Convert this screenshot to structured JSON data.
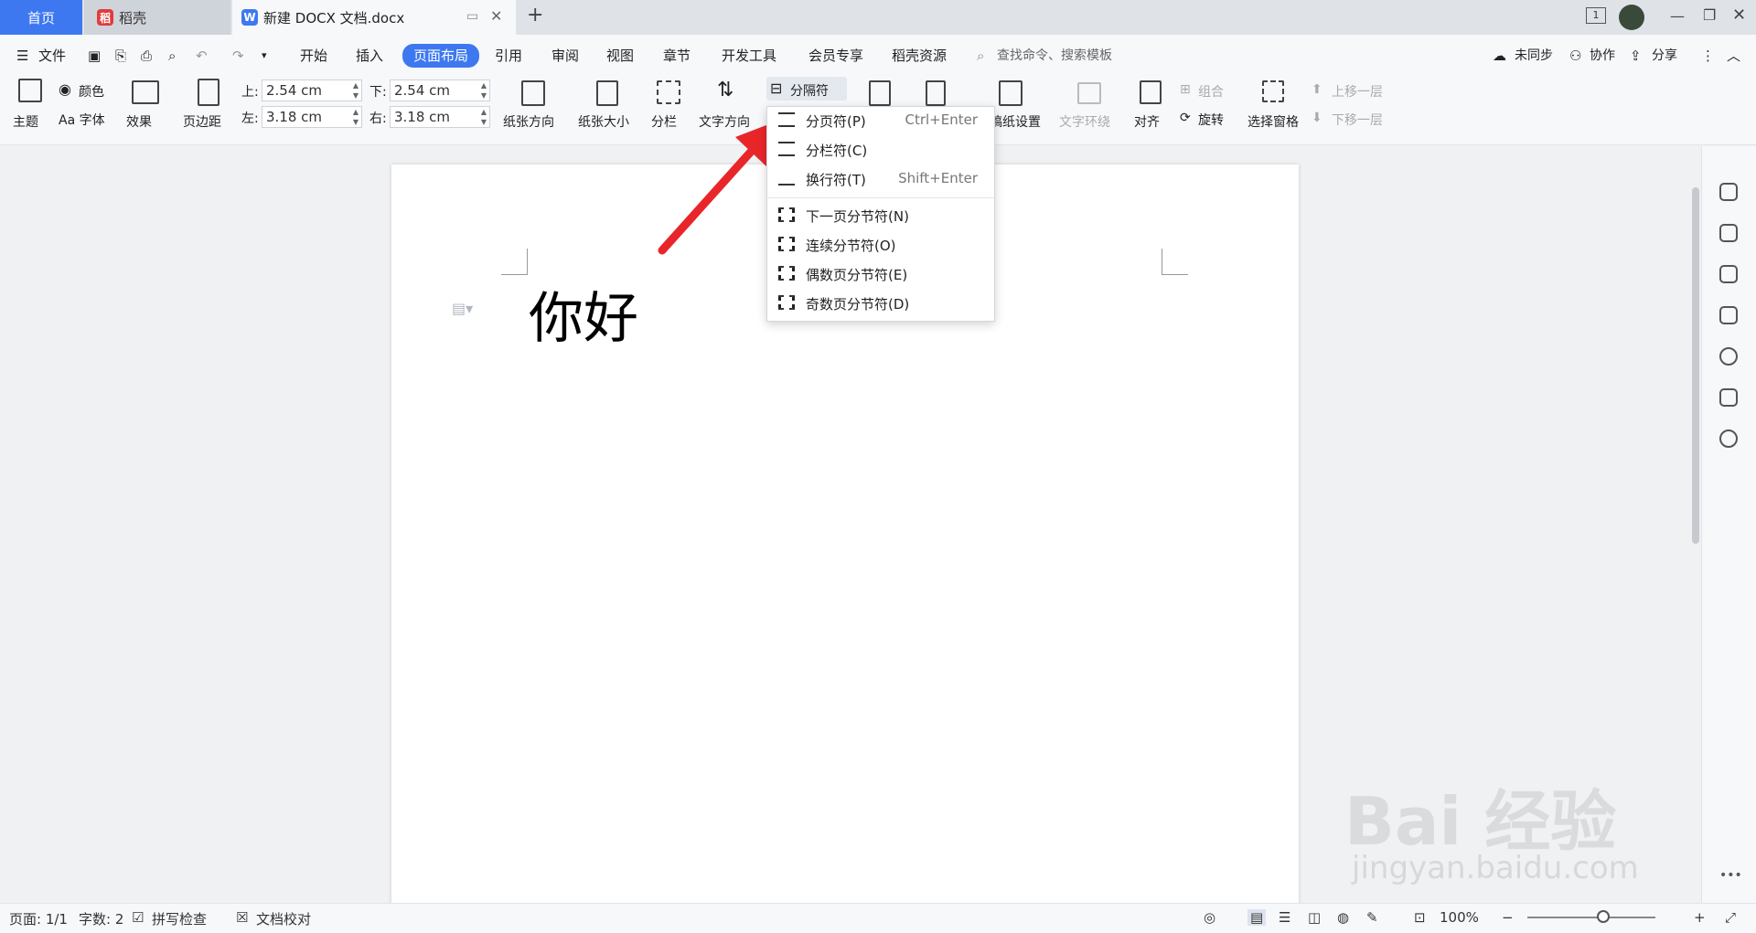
{
  "tabs": {
    "home": "首页",
    "daoke": "稻壳",
    "doc": "新建 DOCX 文档.docx",
    "add": "+"
  },
  "menu": {
    "file": "文件",
    "items": [
      "开始",
      "插入",
      "页面布局",
      "引用",
      "审阅",
      "视图",
      "章节",
      "开发工具",
      "会员专享",
      "稻壳资源"
    ],
    "search": "查找命令、搜索模板",
    "sync": "未同步",
    "collab": "协作",
    "share": "分享"
  },
  "ribbon": {
    "theme": "主题",
    "color": "颜色",
    "font": "Aa 字体",
    "effect": "效果",
    "margins": "页边距",
    "top_label": "上:",
    "top_value": "2.54 cm",
    "bottom_label": "下:",
    "bottom_value": "2.54 cm",
    "left_label": "左:",
    "left_value": "3.18 cm",
    "right_label": "右:",
    "right_value": "3.18 cm",
    "orientation": "纸张方向",
    "size": "纸张大小",
    "columns": "分栏",
    "text_direction": "文字方向",
    "breaks": "分隔符",
    "paper_setting": "稿纸设置",
    "text_wrap": "文字环绕",
    "align": "对齐",
    "rotate": "旋转",
    "group": "组合",
    "selection_pane": "选择窗格",
    "bring_forward": "上移一层",
    "send_backward": "下移一层"
  },
  "dropdown": [
    {
      "label": "分页符(P)",
      "shortcut": "Ctrl+Enter"
    },
    {
      "label": "分栏符(C)",
      "shortcut": ""
    },
    {
      "label": "换行符(T)",
      "shortcut": "Shift+Enter"
    },
    {
      "label": "下一页分节符(N)",
      "shortcut": ""
    },
    {
      "label": "连续分节符(O)",
      "shortcut": ""
    },
    {
      "label": "偶数页分节符(E)",
      "shortcut": ""
    },
    {
      "label": "奇数页分节符(D)",
      "shortcut": ""
    }
  ],
  "document": {
    "text": "你好"
  },
  "status": {
    "page": "页面: 1/1",
    "words": "字数: 2",
    "spell": "拼写检查",
    "proof": "文档校对",
    "zoom": "100%"
  },
  "watermark": {
    "brand": "Bai 经验",
    "url": "jingyan.baidu.com"
  },
  "colors": {
    "accent": "#3e78f0",
    "arrow": "#e8262a"
  }
}
